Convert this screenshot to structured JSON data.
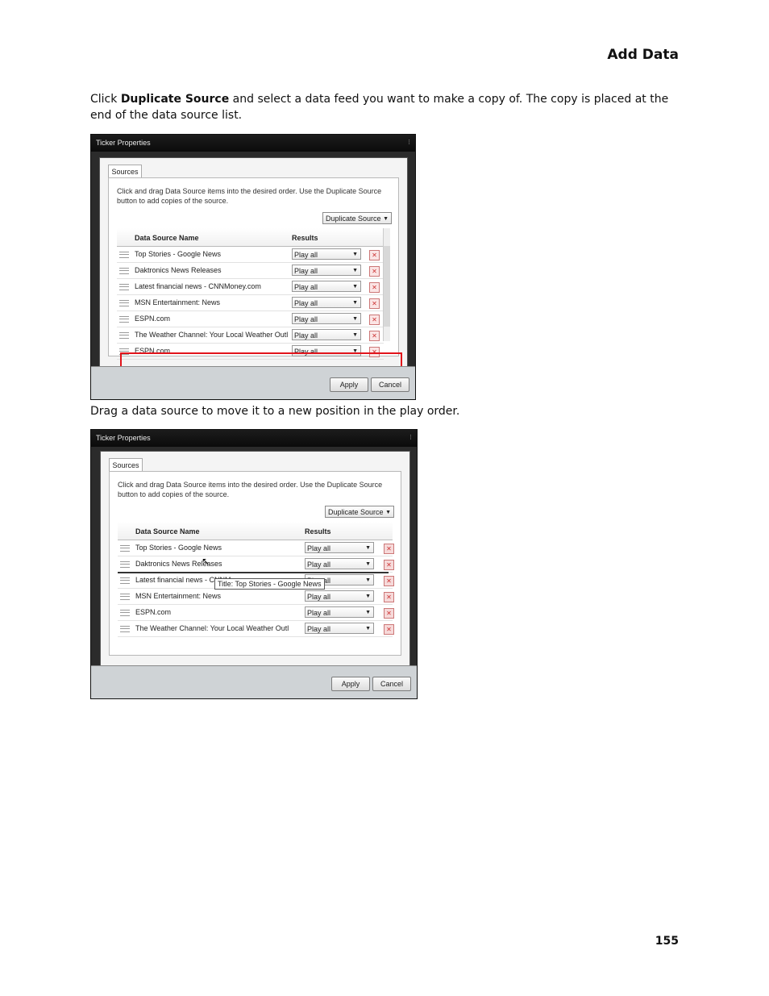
{
  "section_title": "Add Data",
  "intro": {
    "click": "Click ",
    "button_name": "Duplicate Source",
    "rest": " and select a data feed you want to make a copy of. The copy is placed at the end of the data source list."
  },
  "drag_caption": "Drag a data source to move it to a new position in the play order.",
  "page_number": "155",
  "dialog1": {
    "title": "Ticker Properties",
    "tab": "Sources",
    "instructions": "Click and drag Data Source items into the desired order. Use the Duplicate Source button to add copies of the source.",
    "duplicate_button": "Duplicate Source",
    "col_name": "Data Source Name",
    "col_results": "Results",
    "rows": [
      {
        "name": "Top Stories - Google News",
        "result": "Play all"
      },
      {
        "name": "Daktronics News Releases",
        "result": "Play all"
      },
      {
        "name": "Latest financial news - CNNMoney.com",
        "result": "Play all"
      },
      {
        "name": "MSN Entertainment: News",
        "result": "Play all"
      },
      {
        "name": "ESPN.com",
        "result": "Play all"
      },
      {
        "name": "The Weather Channel: Your Local Weather Outl",
        "result": "Play all"
      },
      {
        "name": "ESPN.com",
        "result": "Play all"
      }
    ],
    "apply": "Apply",
    "cancel": "Cancel"
  },
  "dialog2": {
    "title": "Ticker Properties",
    "tab": "Sources",
    "instructions": "Click and drag Data Source items into the desired order. Use the Duplicate Source button to add copies of the source.",
    "duplicate_button": "Duplicate Source",
    "col_name": "Data Source Name",
    "col_results": "Results",
    "rows": [
      {
        "name": "Top Stories - Google News",
        "result": "Play all"
      },
      {
        "name": "Daktronics News Releases",
        "result": "Play all"
      },
      {
        "name": "Latest financial news - CNNMoney.com",
        "result": "Play all"
      },
      {
        "name": "MSN Entertainment: News",
        "result": "Play all"
      },
      {
        "name": "ESPN.com",
        "result": "Play all"
      },
      {
        "name": "The Weather Channel: Your Local Weather Outlool",
        "result": "Play all"
      }
    ],
    "drag_ghost": "Title: Top Stories - Google News",
    "apply": "Apply",
    "cancel": "Cancel"
  }
}
